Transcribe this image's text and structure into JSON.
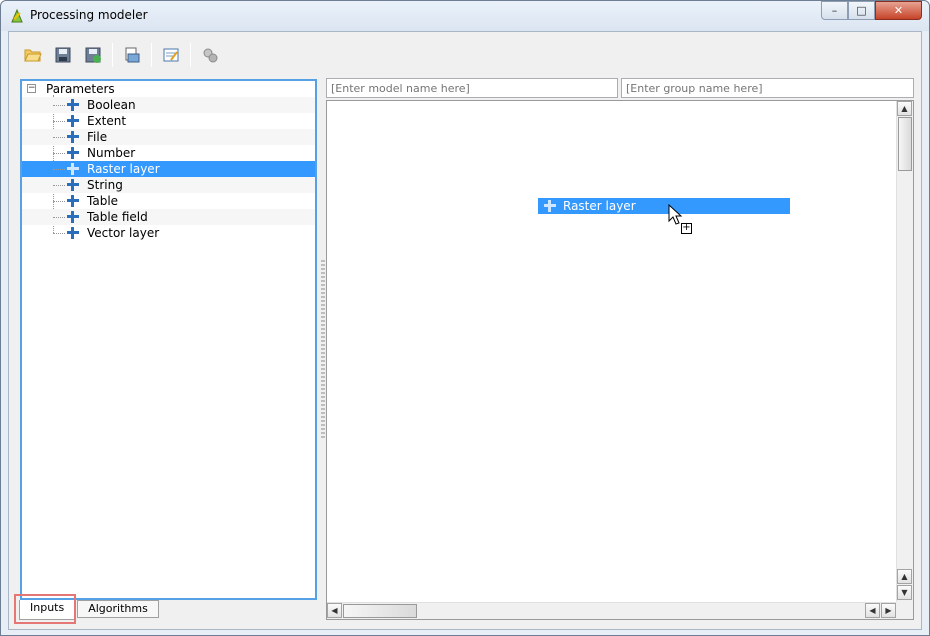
{
  "window": {
    "title": "Processing modeler"
  },
  "toolbar": {
    "buttons": [
      {
        "name": "open-model",
        "icon": "folder-open-icon"
      },
      {
        "name": "save-model",
        "icon": "save-icon"
      },
      {
        "name": "save-as-model",
        "icon": "save-as-icon"
      },
      {
        "name": "export-image",
        "icon": "export-image-icon"
      },
      {
        "name": "edit-help",
        "icon": "edit-help-icon"
      },
      {
        "name": "run-model",
        "icon": "gears-icon"
      }
    ]
  },
  "tree": {
    "root": "Parameters",
    "items": [
      {
        "label": "Boolean"
      },
      {
        "label": "Extent"
      },
      {
        "label": "File"
      },
      {
        "label": "Number"
      },
      {
        "label": "Raster layer",
        "selected": true
      },
      {
        "label": "String"
      },
      {
        "label": "Table"
      },
      {
        "label": "Table field"
      },
      {
        "label": "Vector layer"
      }
    ]
  },
  "tabs": [
    {
      "label": "Inputs",
      "active": true
    },
    {
      "label": "Algorithms",
      "active": false
    }
  ],
  "model_name": {
    "placeholder": "[Enter model name here]"
  },
  "group_name": {
    "placeholder": "[Enter group name here]"
  },
  "canvas": {
    "drag_item": "Raster layer"
  },
  "colors": {
    "selection": "#3399ff",
    "focus_border": "#56a0e6",
    "highlight_box": "#e57676"
  }
}
